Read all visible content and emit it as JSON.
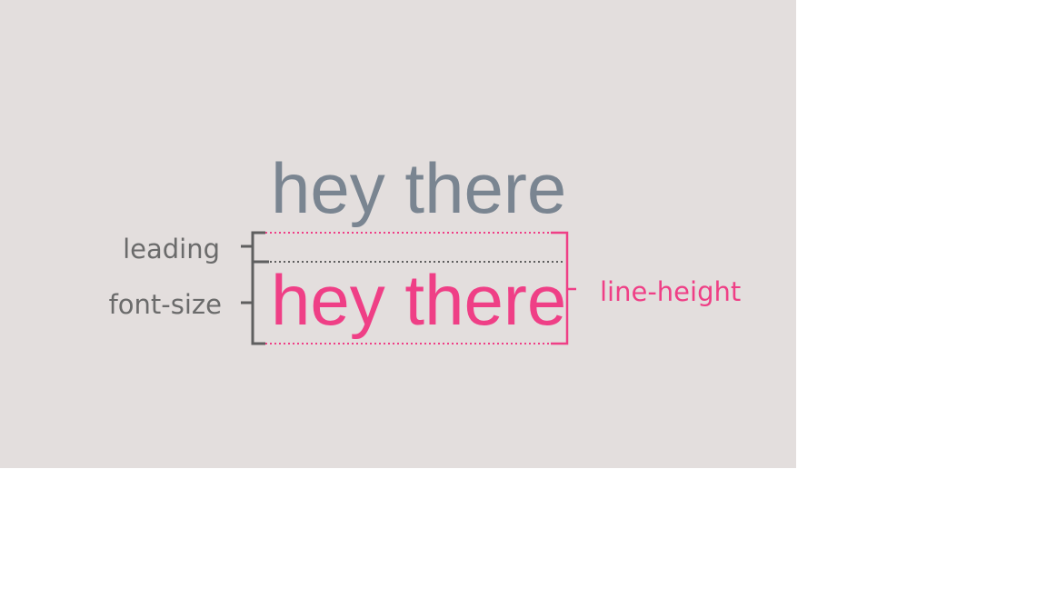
{
  "diagram": {
    "top_sample_text": "hey there",
    "bottom_sample_text": "hey there",
    "labels": {
      "leading": "leading",
      "font_size": "font-size",
      "line_height": "line-height"
    }
  },
  "colors": {
    "panel_background": "#e3dedd",
    "page_background": "#ffffff",
    "grey_text": "#7a8591",
    "pink_accent": "#ef3f86",
    "bracket_grey": "#5f5f5f",
    "label_grey": "#6b6b6b"
  }
}
